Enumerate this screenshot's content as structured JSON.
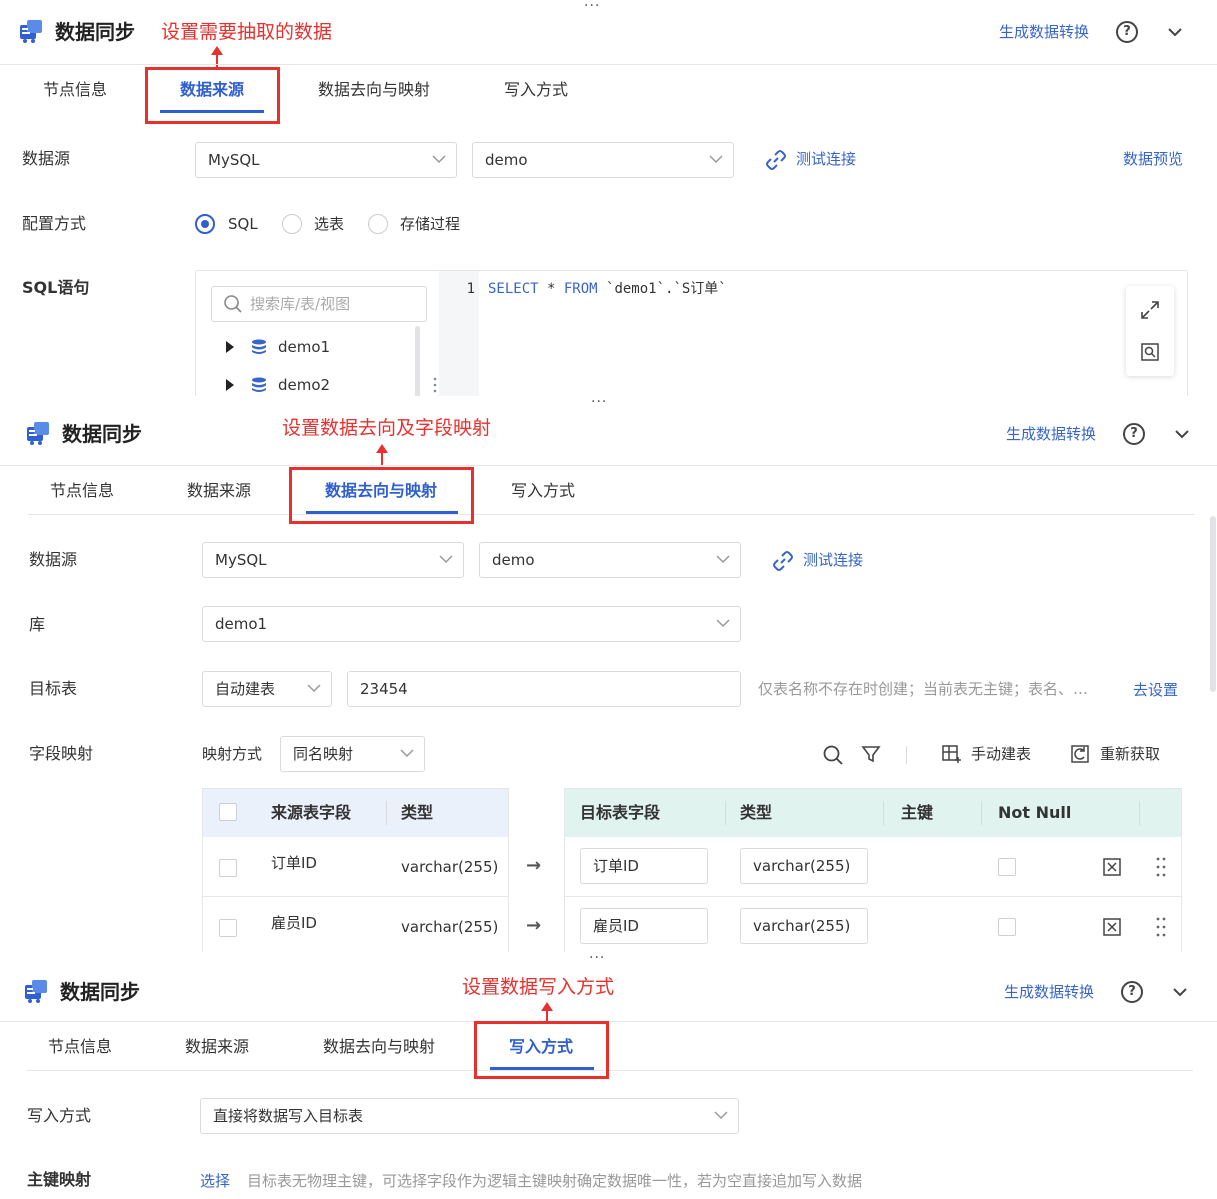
{
  "common": {
    "title": "数据同步",
    "header_link": "生成数据转换",
    "help_glyph": "?",
    "grip": "···",
    "tabs": [
      "节点信息",
      "数据来源",
      "数据去向与映射",
      "写入方式"
    ]
  },
  "annotations": {
    "p1": "设置需要抽取的数据",
    "p2": "设置数据去向及字段映射",
    "p3": "设置数据写入方式"
  },
  "source": {
    "label_datasource": "数据源",
    "datasource_type": "MySQL",
    "datasource_conn": "demo",
    "test_connection": "测试连接",
    "preview": "数据预览",
    "label_config": "配置方式",
    "config_options": [
      "SQL",
      "选表",
      "存储过程"
    ],
    "config_selected": "SQL",
    "label_sql": "SQL语句",
    "search_placeholder": "搜索库/表/视图",
    "tree": [
      "demo1",
      "demo2"
    ],
    "line_no": "1",
    "sql_kw1": "SELECT",
    "sql_star": " * ",
    "sql_kw2": "FROM",
    "sql_rest": " `demo1`.`S订单`"
  },
  "target": {
    "label_datasource": "数据源",
    "datasource_type": "MySQL",
    "datasource_conn": "demo",
    "test_connection": "测试连接",
    "label_db": "库",
    "db": "demo1",
    "label_table": "目标表",
    "table_mode": "自动建表",
    "table_name": "23454",
    "table_hint": "仅表名称不存在时创建；当前表无主键；表名、…",
    "goto_settings": "去设置",
    "label_mapping": "字段映射",
    "mapping_mode_label": "映射方式",
    "mapping_mode": "同名映射",
    "manual_create": "手动建表",
    "refetch": "重新获取",
    "source_headers": [
      "来源表字段",
      "类型"
    ],
    "target_headers": [
      "目标表字段",
      "类型",
      "主键",
      "Not Null"
    ],
    "arrow": "→",
    "rows": [
      {
        "src_field": "订单ID",
        "src_type": "varchar(255)",
        "dst_field": "订单ID",
        "dst_type": "varchar(255)"
      },
      {
        "src_field": "雇员ID",
        "src_type": "varchar(255)",
        "dst_field": "雇员ID",
        "dst_type": "varchar(255)"
      }
    ]
  },
  "write": {
    "label_mode": "写入方式",
    "mode": "直接将数据写入目标表",
    "label_pk": "主键映射",
    "select": "选择",
    "pk_hint": "目标表无物理主键，可选择字段作为逻辑主键映射确定数据唯一性，若为空直接追加写入数据"
  },
  "colors": {
    "accent": "#2f5fd0",
    "annotation_red": "#e8312e",
    "target_header_bg": "#e0f3ee",
    "source_header_bg": "#eaf1fb"
  }
}
